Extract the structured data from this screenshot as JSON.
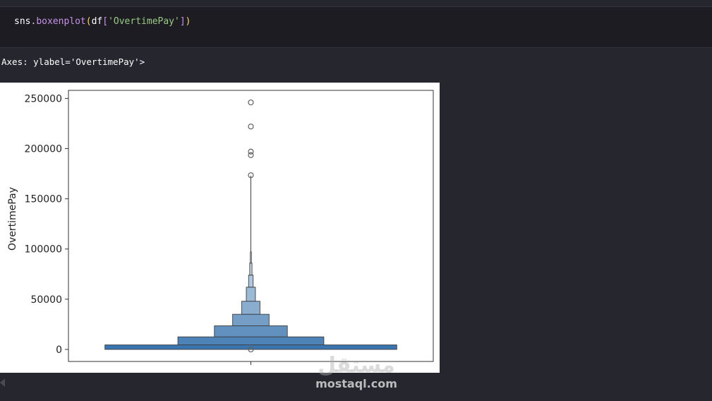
{
  "code_cell": {
    "tokens": {
      "var": "sns",
      "dot": ".",
      "fn": "boxenplot",
      "paren_open": "(",
      "arg_var": "df",
      "bracket_open": "[",
      "string": "'OvertimePay'",
      "bracket_close": "]",
      "paren_close": ")"
    }
  },
  "output": {
    "text": "Axes: ylabel='OvertimePay'>"
  },
  "watermark": {
    "logo_text": "مستقل",
    "site_text": "mostaql.com"
  },
  "chart_data": {
    "type": "boxen",
    "ylabel": "OvertimePay",
    "xlabel": "",
    "ylim": [
      -12000,
      258000
    ],
    "yticks": [
      0,
      50000,
      100000,
      150000,
      200000,
      250000
    ],
    "ytick_labels": [
      "0",
      "50000",
      "100000",
      "150000",
      "200000",
      "250000"
    ],
    "color": "#3b75af",
    "boxes": [
      {
        "low": 0,
        "high": 4500,
        "width": 0.8
      },
      {
        "low": 4500,
        "high": 12500,
        "width": 0.4
      },
      {
        "low": 12500,
        "high": 23500,
        "width": 0.2
      },
      {
        "low": 23500,
        "high": 35000,
        "width": 0.1
      },
      {
        "low": 35000,
        "high": 48000,
        "width": 0.05
      },
      {
        "low": 48000,
        "high": 62000,
        "width": 0.025
      },
      {
        "low": 62000,
        "high": 74000,
        "width": 0.0125
      },
      {
        "low": 74000,
        "high": 86000,
        "width": 0.00625
      },
      {
        "low": 86000,
        "high": 97000,
        "width": 0.003
      }
    ],
    "whisker": {
      "low": 97000,
      "high": 173000
    },
    "outliers": [
      173500,
      193500,
      197000,
      222000,
      246000,
      0
    ]
  }
}
